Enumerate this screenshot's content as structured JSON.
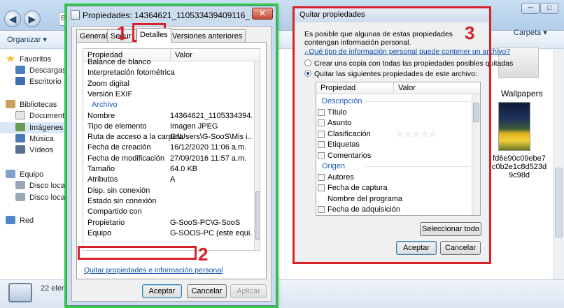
{
  "explorer": {
    "addr_fragment": "Bi",
    "toolbar": {
      "organizar": "Organizar ▾",
      "view": "Carpeta ▾"
    },
    "nav": {
      "favoritos": "Favoritos",
      "descargas": "Descargas",
      "escritorio": "Escritorio",
      "bibliotecas": "Bibliotecas",
      "documentos": "Documentos",
      "imagenes": "Imágenes",
      "musica": "Música",
      "videos": "Vídeos",
      "equipo": "Equipo",
      "disco_c": "Disco local (C",
      "disco_d": "Disco local (D",
      "red": "Red"
    },
    "content": {
      "wallpapers": "Wallpapers",
      "thumb_name": "fd6e90c09ebe7c0b2e1c8d523d9c98d"
    },
    "status": "22 elem"
  },
  "props": {
    "title": "Propiedades: 14364621_110533439409116_69703844...",
    "tabs": [
      "General",
      "Segur",
      "Detalles",
      "Versiones anteriores"
    ],
    "header": {
      "prop": "Propiedad",
      "valor": "Valor"
    },
    "rows": [
      {
        "k": "Balance de blanco",
        "v": ""
      },
      {
        "k": "Interpretación fotométrica",
        "v": ""
      },
      {
        "k": "Zoom digital",
        "v": ""
      },
      {
        "k": "Versión EXIF",
        "v": ""
      },
      {
        "k": "Archivo",
        "v": "",
        "group": true
      },
      {
        "k": "Nombre",
        "v": "14364621_1105334394..."
      },
      {
        "k": "Tipo de elemento",
        "v": "Imagen JPEG"
      },
      {
        "k": "Ruta de acceso a la carpeta",
        "v": "C:\\Users\\G-SooS\\Mis i..."
      },
      {
        "k": "Fecha de creación",
        "v": "16/12/2020 11:06 a.m."
      },
      {
        "k": "Fecha de modificación",
        "v": "27/09/2016 11:57 a.m."
      },
      {
        "k": "Tamaño",
        "v": "64.0 KB"
      },
      {
        "k": "Atributos",
        "v": "A"
      },
      {
        "k": "Disp. sin conexión",
        "v": ""
      },
      {
        "k": "Estado sin conexión",
        "v": ""
      },
      {
        "k": "Compartido con",
        "v": ""
      },
      {
        "k": "Propietario",
        "v": "G-SooS-PC\\G-SooS"
      },
      {
        "k": "Equipo",
        "v": "G-SOOS-PC (este equi..."
      }
    ],
    "remove_link": "Quitar propiedades e información personal",
    "buttons": {
      "aceptar": "Aceptar",
      "cancelar": "Cancelar",
      "aplicar": "Aplicar"
    }
  },
  "quitar": {
    "title": "Quitar propiedades",
    "desc": "Es posible que algunas de estas propiedades contengan información personal.",
    "link": "¿Qué tipo de información personal puede contener un archivo?",
    "radio1": "Crear una copia con todas las propiedades posibles quitadas",
    "radio2": "Quitar las siguientes propiedades de este archivo:",
    "header": {
      "prop": "Propiedad",
      "valor": "Valor"
    },
    "items": [
      {
        "label": "Descripción",
        "group": true
      },
      {
        "label": "Título",
        "check": true
      },
      {
        "label": "Asunto",
        "check": true
      },
      {
        "label": "Clasificación",
        "check": true,
        "stars": "☆☆☆☆☆"
      },
      {
        "label": "Etiquetas",
        "check": true
      },
      {
        "label": "Comentarios",
        "check": true
      },
      {
        "label": "Origen",
        "group": true
      },
      {
        "label": "Autores",
        "check": true
      },
      {
        "label": "Fecha de captura",
        "check": true
      },
      {
        "label": "Nombre del programa",
        "check": false
      },
      {
        "label": "Fecha de adquisición",
        "check": true
      },
      {
        "label": "Copyright",
        "check": true
      }
    ],
    "select_all": "Seleccionar todo",
    "buttons": {
      "aceptar": "Aceptar",
      "cancelar": "Cancelar"
    }
  },
  "annotations": {
    "n1": "1",
    "n2": "2",
    "n3": "3"
  },
  "colors": {
    "annotation_red": "#d8212d",
    "highlight_green": "#2ecc40",
    "link_blue": "#0a4ea8"
  }
}
